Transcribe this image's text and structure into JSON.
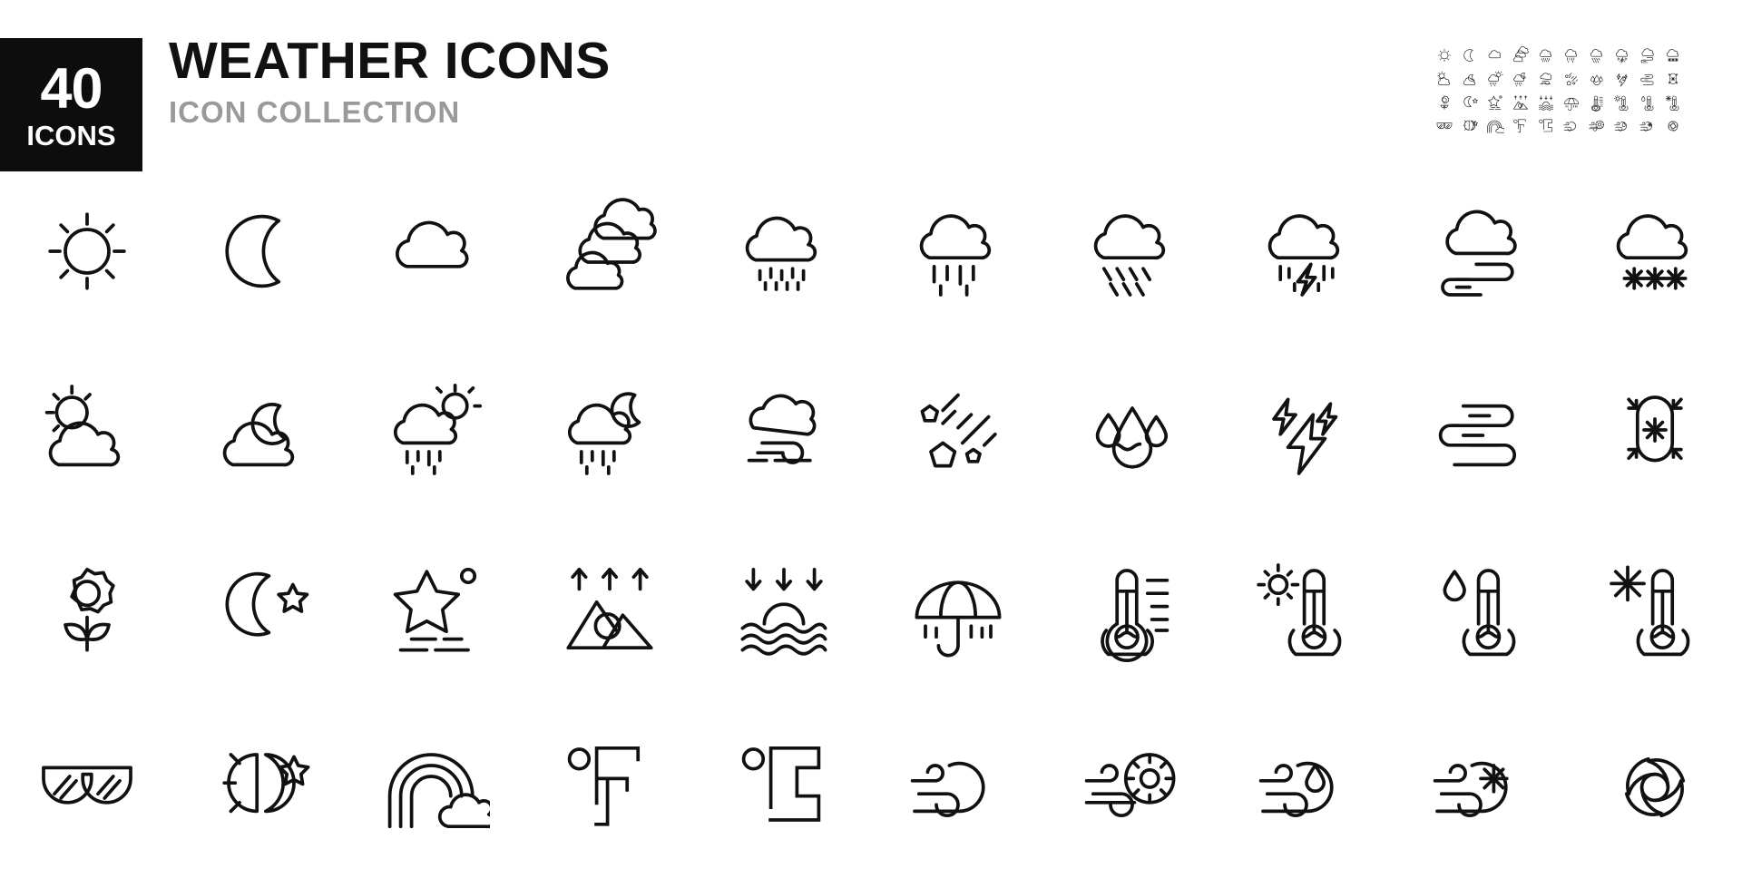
{
  "header": {
    "badge_count": "40",
    "badge_word": "ICONS",
    "title": "WEATHER ICONS",
    "subtitle": "ICON COLLECTION",
    "badge_bg": "#0d0d0d",
    "title_color": "#111111",
    "subtitle_color": "#9a9a9a"
  },
  "grid": {
    "columns": 10,
    "rows": 4,
    "stroke_color": "#111111",
    "background": "#ffffff"
  },
  "icons": [
    {
      "id": "sun",
      "label": "sun",
      "row": 1,
      "col": 1
    },
    {
      "id": "moon",
      "label": "moon",
      "row": 1,
      "col": 2
    },
    {
      "id": "cloud",
      "label": "cloud",
      "row": 1,
      "col": 3
    },
    {
      "id": "clouds",
      "label": "clouds",
      "row": 1,
      "col": 4
    },
    {
      "id": "cloud-drizzle",
      "label": "cloud with drizzle",
      "row": 1,
      "col": 5
    },
    {
      "id": "cloud-rain",
      "label": "cloud with rain",
      "row": 1,
      "col": 6
    },
    {
      "id": "cloud-showers",
      "label": "cloud with showers",
      "row": 1,
      "col": 7
    },
    {
      "id": "cloud-thunderstorm",
      "label": "cloud with thunderstorm",
      "row": 1,
      "col": 8
    },
    {
      "id": "cloud-wind",
      "label": "cloud with wind",
      "row": 1,
      "col": 9
    },
    {
      "id": "cloud-snow",
      "label": "cloud with snow",
      "row": 1,
      "col": 10
    },
    {
      "id": "sun-cloud",
      "label": "partly cloudy day",
      "row": 2,
      "col": 1
    },
    {
      "id": "moon-cloud",
      "label": "partly cloudy night",
      "row": 2,
      "col": 2
    },
    {
      "id": "sun-cloud-rain",
      "label": "day rain",
      "row": 2,
      "col": 3
    },
    {
      "id": "moon-cloud-rain",
      "label": "night rain",
      "row": 2,
      "col": 4
    },
    {
      "id": "cloud-fog",
      "label": "foggy cloud",
      "row": 2,
      "col": 5
    },
    {
      "id": "meteor-hail",
      "label": "meteor hail",
      "row": 2,
      "col": 6
    },
    {
      "id": "humidity",
      "label": "humidity drops",
      "row": 2,
      "col": 7
    },
    {
      "id": "lightning-bolts",
      "label": "lightning bolts",
      "row": 2,
      "col": 8
    },
    {
      "id": "wind-lines",
      "label": "wind lines",
      "row": 2,
      "col": 9
    },
    {
      "id": "snowman-cold",
      "label": "snow cold",
      "row": 2,
      "col": 10
    },
    {
      "id": "flower-spring",
      "label": "flower spring",
      "row": 3,
      "col": 1
    },
    {
      "id": "moon-star",
      "label": "moon and star",
      "row": 3,
      "col": 2
    },
    {
      "id": "star-haze",
      "label": "starry night haze",
      "row": 3,
      "col": 3
    },
    {
      "id": "sunrise-mountains",
      "label": "sunrise over mountains",
      "row": 3,
      "col": 4
    },
    {
      "id": "sunset-sea",
      "label": "sunset over sea",
      "row": 3,
      "col": 5
    },
    {
      "id": "umbrella-rain",
      "label": "umbrella in rain",
      "row": 3,
      "col": 6
    },
    {
      "id": "thermometer-scale",
      "label": "thermometer with scale",
      "row": 3,
      "col": 7
    },
    {
      "id": "thermometer-sun",
      "label": "thermometer hot",
      "row": 3,
      "col": 8
    },
    {
      "id": "thermometer-drop",
      "label": "thermometer humidity",
      "row": 3,
      "col": 9
    },
    {
      "id": "thermometer-snow",
      "label": "thermometer cold",
      "row": 3,
      "col": 10
    },
    {
      "id": "sunglasses",
      "label": "sunglasses",
      "row": 4,
      "col": 1
    },
    {
      "id": "day-night",
      "label": "day and night",
      "row": 4,
      "col": 2
    },
    {
      "id": "rainbow",
      "label": "rainbow",
      "row": 4,
      "col": 3
    },
    {
      "id": "fahrenheit",
      "label": "degrees fahrenheit",
      "row": 4,
      "col": 4
    },
    {
      "id": "celsius",
      "label": "degrees celsius",
      "row": 4,
      "col": 5
    },
    {
      "id": "wind-cloud",
      "label": "windy cloud",
      "row": 4,
      "col": 6
    },
    {
      "id": "wind-sun",
      "label": "windy sun",
      "row": 4,
      "col": 7
    },
    {
      "id": "wind-drop",
      "label": "windy rain",
      "row": 4,
      "col": 8
    },
    {
      "id": "wind-snow",
      "label": "windy snow",
      "row": 4,
      "col": 9
    },
    {
      "id": "hurricane",
      "label": "hurricane tornado",
      "row": 4,
      "col": 10
    }
  ]
}
